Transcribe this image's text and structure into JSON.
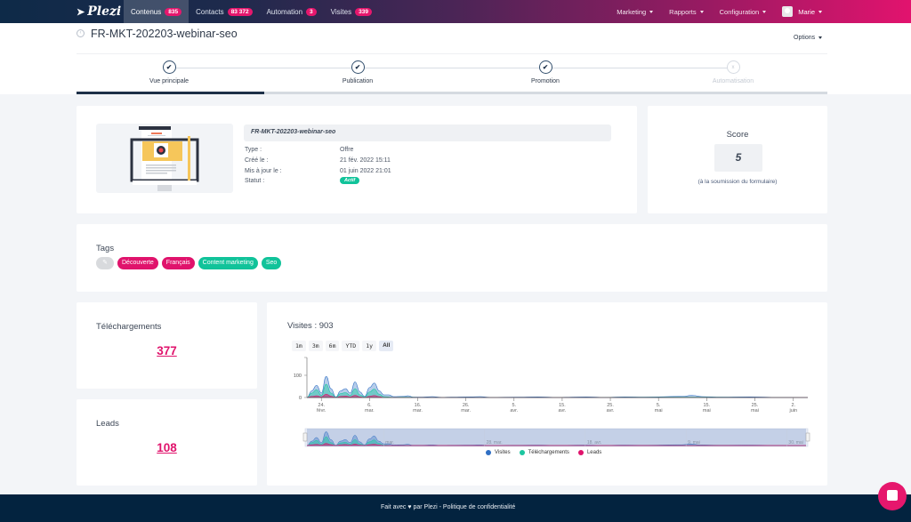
{
  "nav": {
    "brand": "Plezi",
    "tabs": [
      {
        "label": "Contenus",
        "count": "835",
        "active": true
      },
      {
        "label": "Contacts",
        "count": "83 372",
        "active": false
      },
      {
        "label": "Automation",
        "count": "3",
        "active": false
      },
      {
        "label": "Visites",
        "count": "339",
        "active": false
      }
    ],
    "menus": [
      "Marketing",
      "Rapports",
      "Configuration"
    ],
    "user": "Marie"
  },
  "header": {
    "title": "FR-MKT-202203-webinar-seo",
    "options_label": "Options"
  },
  "stepper": {
    "steps": [
      {
        "label": "Vue principale",
        "glyph": "✔",
        "done": true
      },
      {
        "label": "Publication",
        "glyph": "✔",
        "done": true
      },
      {
        "label": "Promotion",
        "glyph": "✔",
        "done": true
      },
      {
        "label": "Automatisation",
        "glyph": "x",
        "done": false
      }
    ],
    "active_step_index": 0,
    "progress_fraction": 0.25
  },
  "content": {
    "name": "FR-MKT-202203-webinar-seo",
    "fields": [
      {
        "label": "Type :",
        "value": "Offre"
      },
      {
        "label": "Créé le :",
        "value": "21 fév. 2022 15:11"
      },
      {
        "label": "Mis à jour le :",
        "value": "01 juin 2022 21:01"
      },
      {
        "label": "Statut :",
        "value": "Actif"
      }
    ]
  },
  "score": {
    "title": "Score",
    "value": "5",
    "subtitle": "(à la soumission du formulaire)"
  },
  "tags": {
    "title": "Tags",
    "edit_icon": "pencil-icon",
    "items": [
      {
        "label": "Découverte",
        "color": "#e0136c"
      },
      {
        "label": "Français",
        "color": "#e0136c"
      },
      {
        "label": "Content marketing",
        "color": "#11c39a"
      },
      {
        "label": "Seo",
        "color": "#11c39a"
      }
    ]
  },
  "stats": {
    "downloads": {
      "title": "Téléchargements",
      "value": "377"
    },
    "leads": {
      "title": "Leads",
      "value": "108"
    }
  },
  "visits": {
    "title": "Visites : 903",
    "ranges": [
      "1m",
      "3m",
      "6m",
      "YTD",
      "1y",
      "All"
    ],
    "active_range": "All"
  },
  "chart_data": {
    "type": "area",
    "title": "Visites : 903",
    "x_ticks": [
      {
        "d": 3,
        "day": "24.",
        "month": "févr."
      },
      {
        "d": 13,
        "day": "6.",
        "month": "mar."
      },
      {
        "d": 23,
        "day": "16.",
        "month": "mar."
      },
      {
        "d": 33,
        "day": "26.",
        "month": "mar."
      },
      {
        "d": 43,
        "day": "5.",
        "month": "avr."
      },
      {
        "d": 53,
        "day": "15.",
        "month": "avr."
      },
      {
        "d": 63,
        "day": "25.",
        "month": "avr."
      },
      {
        "d": 73,
        "day": "5.",
        "month": "mai"
      },
      {
        "d": 83,
        "day": "15.",
        "month": "mai"
      },
      {
        "d": 93,
        "day": "25.",
        "month": "mai"
      },
      {
        "d": 101,
        "day": "2.",
        "month": "juin"
      }
    ],
    "y_ticks": [
      0,
      100
    ],
    "ylim": [
      0,
      180
    ],
    "xlim": [
      0,
      104
    ],
    "navigator_labels": [
      "mar.",
      "28. mar.",
      "18. avr.",
      "9. mai",
      "30. mai"
    ],
    "series": [
      {
        "name": "Visites",
        "color": "#2f6fc4",
        "points": [
          [
            0,
            0
          ],
          [
            1,
            30
          ],
          [
            2,
            55
          ],
          [
            3,
            20
          ],
          [
            4,
            95
          ],
          [
            5,
            40
          ],
          [
            6,
            2
          ],
          [
            7,
            30
          ],
          [
            8,
            40
          ],
          [
            9,
            20
          ],
          [
            10,
            70
          ],
          [
            11,
            25
          ],
          [
            12,
            5
          ],
          [
            13,
            45
          ],
          [
            14,
            65
          ],
          [
            15,
            30
          ],
          [
            16,
            12
          ],
          [
            17,
            12
          ],
          [
            18,
            4
          ],
          [
            20,
            5
          ],
          [
            21,
            8
          ],
          [
            22,
            2
          ],
          [
            24,
            2
          ],
          [
            26,
            4
          ],
          [
            28,
            1
          ],
          [
            30,
            2
          ],
          [
            34,
            3
          ],
          [
            36,
            4
          ],
          [
            38,
            1
          ],
          [
            44,
            2
          ],
          [
            48,
            3
          ],
          [
            52,
            1
          ],
          [
            58,
            3
          ],
          [
            62,
            1
          ],
          [
            66,
            3
          ],
          [
            70,
            2
          ],
          [
            78,
            5
          ],
          [
            80,
            10
          ],
          [
            82,
            4
          ],
          [
            86,
            2
          ],
          [
            92,
            3
          ],
          [
            98,
            1
          ],
          [
            104,
            0
          ]
        ]
      },
      {
        "name": "Téléchargements",
        "color": "#1cc6a0",
        "points": [
          [
            0,
            0
          ],
          [
            1,
            20
          ],
          [
            2,
            35
          ],
          [
            3,
            10
          ],
          [
            4,
            60
          ],
          [
            5,
            20
          ],
          [
            6,
            1
          ],
          [
            7,
            18
          ],
          [
            8,
            22
          ],
          [
            9,
            10
          ],
          [
            10,
            40
          ],
          [
            11,
            12
          ],
          [
            12,
            2
          ],
          [
            13,
            25
          ],
          [
            14,
            38
          ],
          [
            15,
            15
          ],
          [
            16,
            4
          ],
          [
            18,
            1
          ],
          [
            20,
            2
          ],
          [
            24,
            1
          ],
          [
            30,
            1
          ],
          [
            40,
            1
          ],
          [
            60,
            1
          ],
          [
            80,
            2
          ],
          [
            104,
            0
          ]
        ]
      },
      {
        "name": "Leads",
        "color": "#e0136c",
        "points": [
          [
            0,
            0
          ],
          [
            1,
            5
          ],
          [
            2,
            8
          ],
          [
            3,
            3
          ],
          [
            4,
            15
          ],
          [
            5,
            6
          ],
          [
            6,
            0
          ],
          [
            7,
            5
          ],
          [
            8,
            7
          ],
          [
            9,
            3
          ],
          [
            10,
            10
          ],
          [
            11,
            3
          ],
          [
            12,
            0
          ],
          [
            13,
            6
          ],
          [
            14,
            9
          ],
          [
            15,
            4
          ],
          [
            16,
            0
          ],
          [
            104,
            0
          ]
        ]
      }
    ],
    "legend": [
      "Visites",
      "Téléchargements",
      "Leads"
    ],
    "legend_position": "bottom"
  },
  "footer": {
    "text_before": "Fait avec",
    "text_after": "par Plezi - Politique de confidentialité"
  }
}
